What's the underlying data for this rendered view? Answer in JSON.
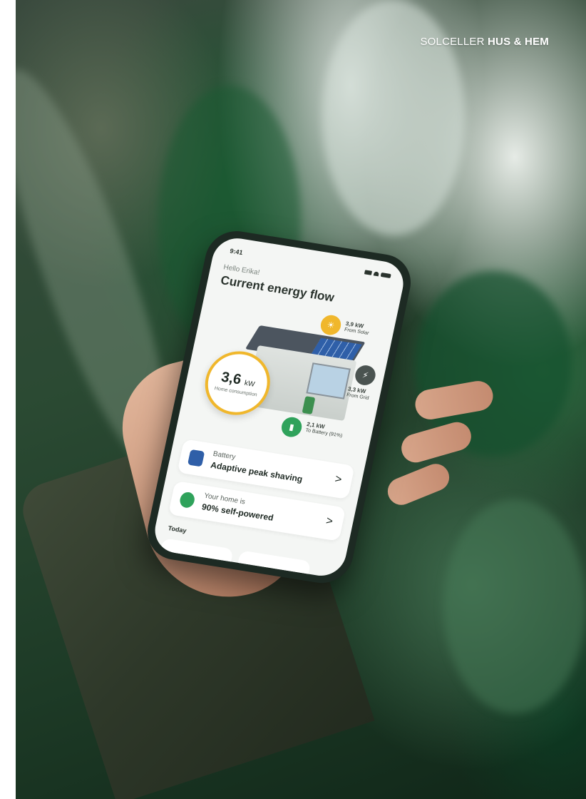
{
  "brand": {
    "prefix": "SOLCELLER",
    "name": "HUS & HEM"
  },
  "phone": {
    "status_time": "9:41",
    "greeting": "Hello Erika!",
    "title": "Current energy flow",
    "home": {
      "value": "3,6",
      "unit": "kW",
      "label": "Home consumption"
    },
    "solar": {
      "value": "3,9 kW",
      "label": "From Solar"
    },
    "grid": {
      "value": "3,3 kW",
      "label": "From Grid"
    },
    "battery_flow": {
      "value": "2,1 kW",
      "label": "To Battery (91%)"
    },
    "cards": [
      {
        "sub": "Battery",
        "main": "Adaptive peak shaving",
        "chevron": ">"
      },
      {
        "sub": "Your home is",
        "main": "90% self-powered",
        "chevron": ">"
      }
    ],
    "today_label": "Today"
  },
  "colors": {
    "accent_yellow": "#f0b72c",
    "accent_green": "#2fa25b",
    "grid_gray": "#4a5350"
  }
}
